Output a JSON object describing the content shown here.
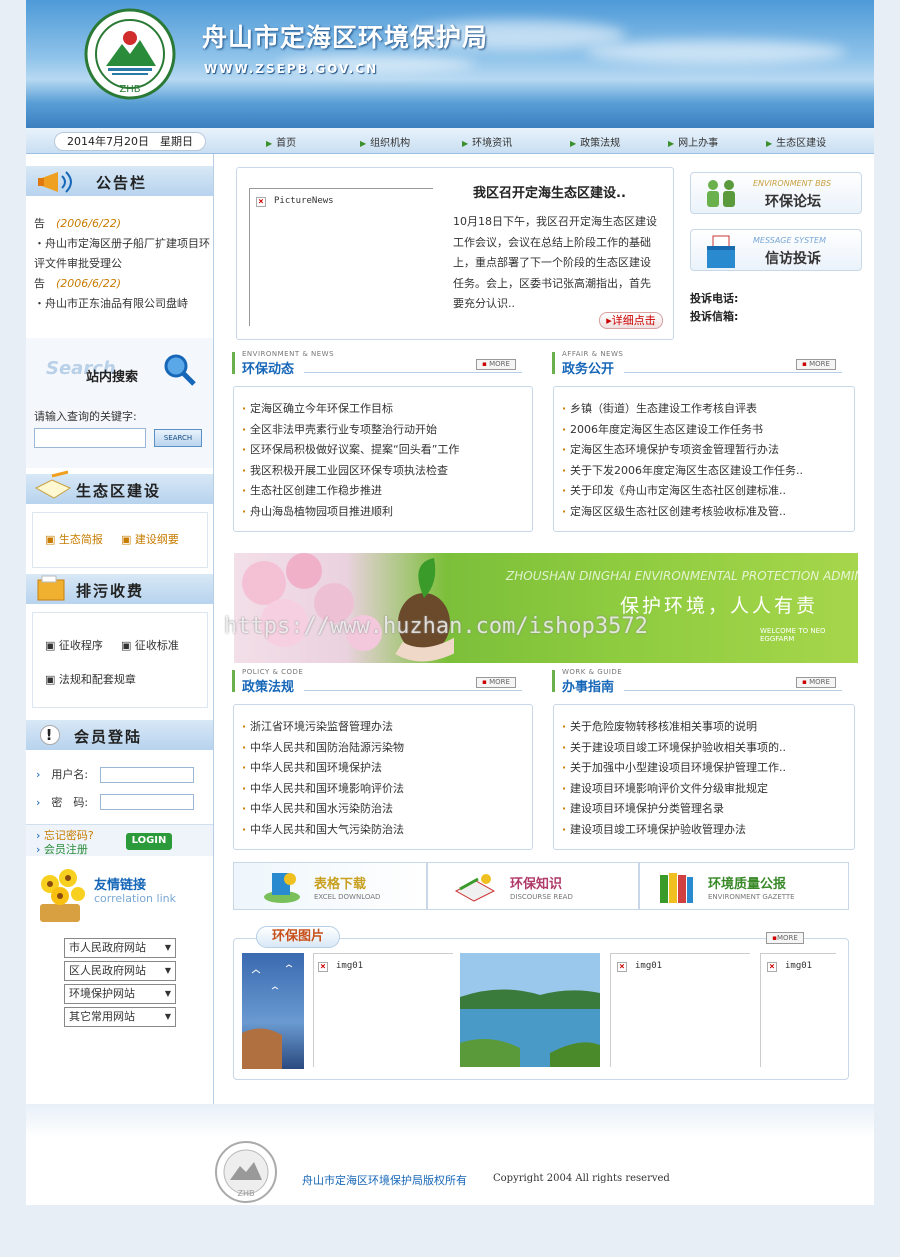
{
  "header": {
    "title": "舟山市定海区环境保护局",
    "url": "WWW.ZSEPB.GOV.CN",
    "logo_text": "ZHB"
  },
  "nav": {
    "date": "2014年7月20日　星期日",
    "items": [
      "首页",
      "组织机构",
      "环境资讯",
      "政策法规",
      "网上办事",
      "生态区建设"
    ]
  },
  "notice": {
    "title": "公告栏",
    "items": [
      {
        "prefix": "告",
        "date": "(2006/6/22)",
        "text": "・舟山市定海区册子船厂扩建项目环评文件审批受理公"
      },
      {
        "prefix": "告",
        "date": "(2006/6/22)",
        "text": "・舟山市正东油品有限公司盘峙"
      }
    ]
  },
  "search": {
    "ghost": "Search",
    "title": "站内搜索",
    "label": "请输入查询的关键字:",
    "button": "SEARCH"
  },
  "eco": {
    "title": "生态区建设",
    "links": [
      "生态简报",
      "建设纲要"
    ]
  },
  "fee": {
    "title": "排污收费",
    "links": [
      "征收程序",
      "征收标准",
      "法规和配套规章"
    ]
  },
  "login": {
    "title": "会员登陆",
    "user_label": "用户名:",
    "pass_label": "密　码:",
    "forgot": "忘记密码?",
    "register": "会员注册",
    "button": "LOGIN"
  },
  "links": {
    "title": "友情链接",
    "subtitle": "correlation link",
    "selects": [
      "市人民政府网站",
      "区人民政府网站",
      "环境保护网站",
      "其它常用网站"
    ]
  },
  "headline": {
    "picture_alt": "PictureNews",
    "title": "我区召开定海生态区建设..",
    "body": "10月18日下午，我区召开定海生态区建设工作会议，会议在总结上阶段工作的基础上，重点部署了下一个阶段的生态区建设任务。会上，区委书记张高潮指出，首先要充分认识..",
    "detail": "详细点击"
  },
  "side_buttons": {
    "bbs_en": "ENVIRONMENT BBS",
    "bbs_cn": "环保论坛",
    "msg_en": "MESSAGE SYSTEM",
    "msg_cn": "信访投诉",
    "phone": "投诉电话:",
    "mailbox": "投诉信箱:"
  },
  "sections": {
    "env_news": {
      "en": "ENVIRONMENT & NEWS",
      "cn": "环保动态",
      "more": "MORE",
      "items": [
        "定海区确立今年环保工作目标",
        "全区非法甲壳素行业专项整治行动开始",
        "区环保局积极做好议案、提案“回头看”工作",
        "我区积极开展工业园区环保专项执法检查",
        "生态社区创建工作稳步推进",
        "舟山海岛植物园项目推进顺利"
      ]
    },
    "gov_open": {
      "en": "AFFAIR & NEWS",
      "cn": "政务公开",
      "more": "MORE",
      "items": [
        "乡镇（街道）生态建设工作考核自评表",
        "2006年度定海区生态区建设工作任务书",
        "定海区生态环境保护专项资金管理暂行办法",
        "关于下发2006年度定海区生态区建设工作任务..",
        "关于印发《舟山市定海区生态社区创建标准..",
        "定海区区级生态社区创建考核验收标准及管.."
      ]
    },
    "policy": {
      "en": "POLICY & CODE",
      "cn": "政策法规",
      "more": "MORE",
      "items": [
        "浙江省环境污染监督管理办法",
        "中华人民共和国防治陆源污染物",
        "中华人民共和国环境保护法",
        "中华人民共和国环境影响评价法",
        "中华人民共和国水污染防治法",
        "中华人民共和国大气污染防治法"
      ]
    },
    "guide": {
      "en": "WORK & GUIDE",
      "cn": "办事指南",
      "more": "MORE",
      "items": [
        "关于危险废物转移核准相关事项的说明",
        "关于建设项目竣工环境保护验收相关事项的..",
        "关于加强中小型建设项目环境保护管理工作..",
        "建设项目环境影响评价文件分级审批规定",
        "建设项目环境保护分类管理名录",
        "建设项目竣工环境保护验收管理办法"
      ]
    }
  },
  "green_banner": {
    "en_title": "ZHOUSHAN DINGHAI ENVIRONMENTAL PROTECTION ADMINISTRATION",
    "slogan": "保护环境，人人有责",
    "welcome": "WELCOME TO NEO EGGFARM",
    "watermark": "https://www.huzhan.com/ishop3572"
  },
  "download_tabs": [
    {
      "cn": "表格下载",
      "en": "EXCEL DOWNLOAD"
    },
    {
      "cn": "环保知识",
      "en": "DISCOURSE READ"
    },
    {
      "cn": "环境质量公报",
      "en": "ENVIRONMENT GAZETTE"
    }
  ],
  "photos": {
    "title": "环保图片",
    "more": "MORE",
    "alts": [
      "img01",
      "img01",
      "img01"
    ]
  },
  "footer": {
    "org": "舟山市定海区环境保护局版权所有",
    "copyright": "Copyright 2004 All rights reserved"
  },
  "colors": {
    "accent": "#1767b8",
    "green": "#6ab04c",
    "orange": "#c77c00"
  }
}
